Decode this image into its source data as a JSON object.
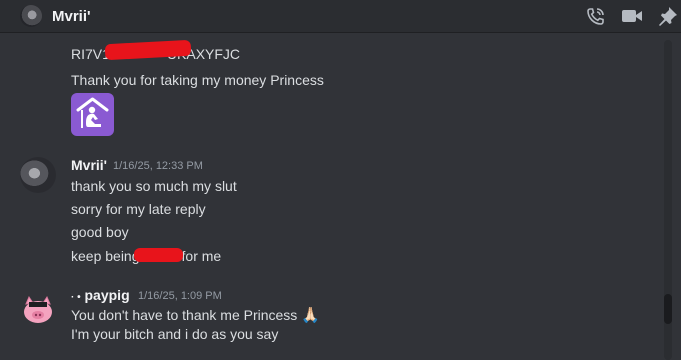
{
  "header": {
    "title": "Mvrii'",
    "icons": [
      "phone-call-icon",
      "video-call-icon",
      "pin-icon"
    ]
  },
  "messages": {
    "prev_lines": [
      "RI7V1",
      "UKAXYFJC",
      "Thank you for taking my money Princess"
    ],
    "prev_emoji": "kneeling-person-emoji",
    "msg1": {
      "author": "Mvrii'",
      "timestamp": "1/16/25, 12:33 PM",
      "lines": [
        "thank you so much my slut",
        "sorry for my late reply",
        "good boy"
      ],
      "last_line_start": "keep being",
      "last_line_end": "for me"
    },
    "msg2": {
      "author_prefix": "· •",
      "author": "paypig",
      "timestamp": "1/16/25, 1:09 PM",
      "line1": "You don't have to thank me Princess",
      "line1_emoji": "🙏🏻",
      "line2": "I'm your bitch and i do as you say"
    }
  },
  "colors": {
    "background": "#313338",
    "header": "#2b2d31",
    "redaction": "#e8141b",
    "emoji_tile": "#8a5ad2"
  }
}
